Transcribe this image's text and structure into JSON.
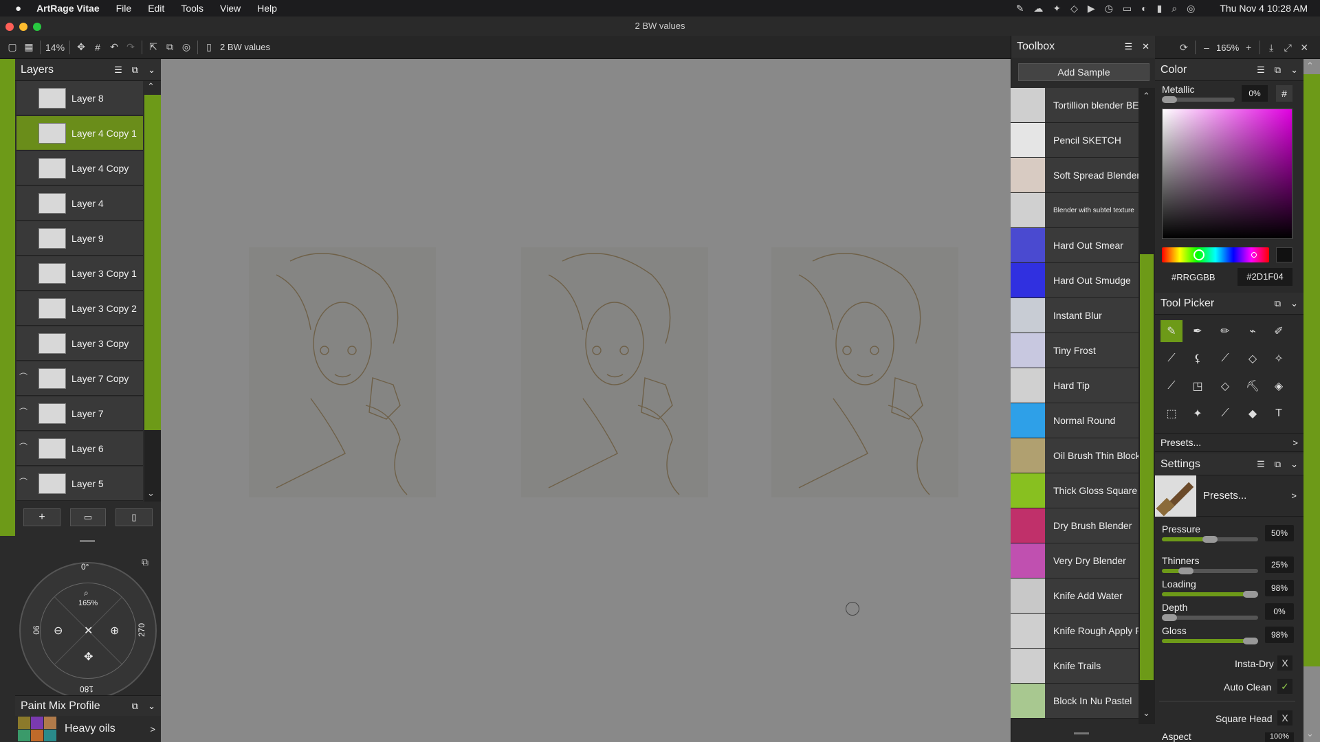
{
  "menubar": {
    "app": "ArtRage Vitae",
    "items": [
      "File",
      "Edit",
      "Tools",
      "View",
      "Help"
    ],
    "datetime": "Thu Nov 4  10:28 AM"
  },
  "window": {
    "title": "2 BW values"
  },
  "toolbar": {
    "zoom": "14%",
    "doc_name": "2 BW values",
    "right_zoom": "165%",
    "minus": "–",
    "plus": "+"
  },
  "layers": {
    "title": "Layers",
    "items": [
      {
        "label": "Layer 8"
      },
      {
        "label": "Layer 4 Copy 1"
      },
      {
        "label": "Layer 4 Copy"
      },
      {
        "label": "Layer 4"
      },
      {
        "label": "Layer 9"
      },
      {
        "label": "Layer 3 Copy 1"
      },
      {
        "label": "Layer 3 Copy 2"
      },
      {
        "label": "Layer 3 Copy"
      },
      {
        "label": "Layer 7 Copy"
      },
      {
        "label": "Layer 7"
      },
      {
        "label": "Layer 6"
      },
      {
        "label": "Layer 5"
      }
    ],
    "add": "+",
    "folder": "folder-icon",
    "trash": "trash-icon"
  },
  "navigator": {
    "top": "0°",
    "zoom": "165%",
    "left": "90",
    "right": "270",
    "bottom": "180"
  },
  "paint_mix": {
    "title": "Paint Mix Profile",
    "profile": "Heavy oils",
    "arrow": ">"
  },
  "toolbox": {
    "title": "Toolbox",
    "add_sample": "Add Sample",
    "items": [
      {
        "label": "Tortillion blender BEST",
        "small": false
      },
      {
        "label": "Pencil SKETCH",
        "small": false
      },
      {
        "label": "Soft Spread Blender",
        "small": false
      },
      {
        "label": "Blender with subtel texture",
        "small": true
      },
      {
        "label": "Hard Out Smear",
        "small": false
      },
      {
        "label": "Hard Out Smudge",
        "small": false
      },
      {
        "label": "Instant Blur",
        "small": false
      },
      {
        "label": "Tiny Frost",
        "small": false
      },
      {
        "label": "Hard Tip",
        "small": false
      },
      {
        "label": "Normal Round",
        "small": false
      },
      {
        "label": "Oil Brush Thin Block In",
        "small": false
      },
      {
        "label": "Thick Gloss Square",
        "small": false
      },
      {
        "label": "Dry Brush Blender",
        "small": false
      },
      {
        "label": "Very Dry Blender",
        "small": false
      },
      {
        "label": "Knife Add Water",
        "small": false
      },
      {
        "label": "Knife Rough Apply Paint",
        "small": false
      },
      {
        "label": "Knife Trails",
        "small": false
      },
      {
        "label": "Block In Nu Pastel",
        "small": false
      }
    ]
  },
  "color": {
    "title": "Color",
    "metallic_label": "Metallic",
    "metallic_value": "0%",
    "hash": "#",
    "hex_label": "#RRGGBB",
    "hex_value": "#2D1F04",
    "current": "#2D1F04"
  },
  "tool_picker": {
    "title": "Tool Picker",
    "presets": "Presets...",
    "arrow": ">"
  },
  "settings": {
    "title": "Settings",
    "presets": "Presets...",
    "arrow": ">",
    "sliders": [
      {
        "label": "Pressure",
        "value": "50%",
        "fraction": 0.5
      },
      {
        "label": "Thinners",
        "value": "25%",
        "fraction": 0.25
      },
      {
        "label": "Loading",
        "value": "98%",
        "fraction": 0.98
      },
      {
        "label": "Depth",
        "value": "0%",
        "fraction": 0.0
      },
      {
        "label": "Gloss",
        "value": "98%",
        "fraction": 0.98
      }
    ],
    "insta_dry": "Insta-Dry",
    "insta_dry_state": "X",
    "auto_clean": "Auto Clean",
    "auto_clean_state": "✓",
    "square_head": "Square Head",
    "square_head_state": "X",
    "aspect": "Aspect",
    "aspect_value": "100%"
  },
  "colors": {
    "accent": "#6d9a18",
    "panel": "#2b2b2b"
  }
}
